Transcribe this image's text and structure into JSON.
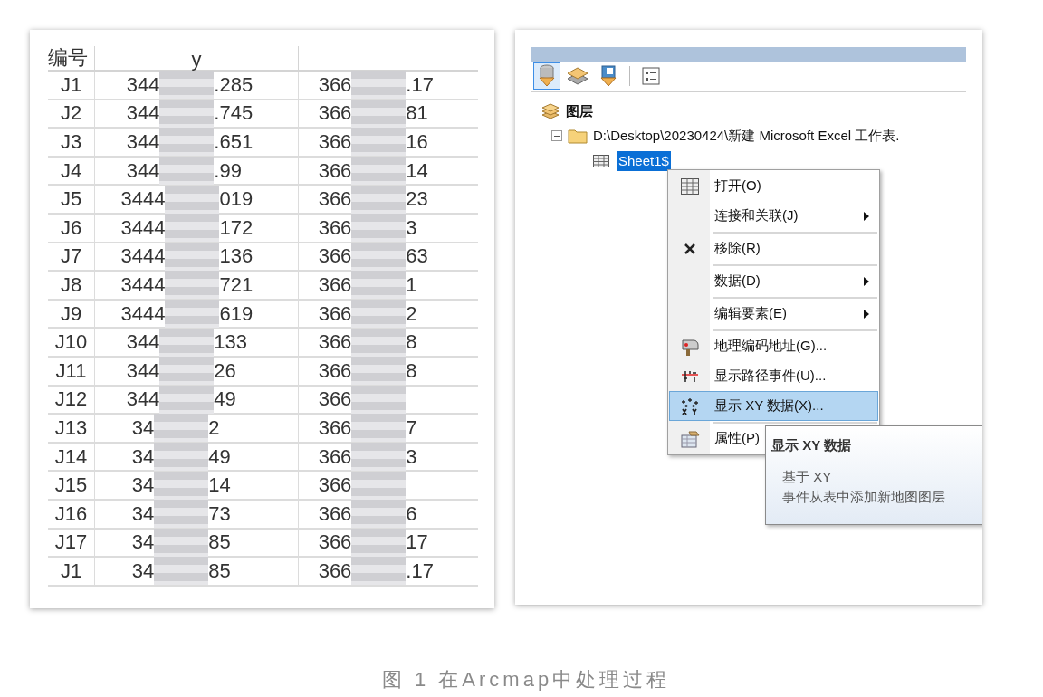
{
  "table": {
    "columns": [
      {
        "label": "编号"
      },
      {
        "label": "y"
      }
    ],
    "rows": [
      {
        "id": "J1",
        "y": {
          "start": "344",
          "end": ".285"
        },
        "column_3": {
          "start": "366",
          "end": ".17"
        }
      },
      {
        "id": "J2",
        "y": {
          "start": "344",
          "end": ".745"
        },
        "column_3": {
          "start": "366",
          "end": "81"
        }
      },
      {
        "id": "J3",
        "y": {
          "start": "344",
          "end": ".651"
        },
        "column_3": {
          "start": "366",
          "end": "16"
        }
      },
      {
        "id": "J4",
        "y": {
          "start": "344",
          "end": ".99"
        },
        "column_3": {
          "start": "366",
          "end": "14"
        }
      },
      {
        "id": "J5",
        "y": {
          "start": "3444",
          "end": "019"
        },
        "column_3": {
          "start": "366",
          "end": "23"
        }
      },
      {
        "id": "J6",
        "y": {
          "start": "3444",
          "end": "172"
        },
        "column_3": {
          "start": "366",
          "end": "3"
        }
      },
      {
        "id": "J7",
        "y": {
          "start": "3444",
          "end": "136"
        },
        "column_3": {
          "start": "366",
          "end": "63"
        }
      },
      {
        "id": "J8",
        "y": {
          "start": "3444",
          "end": "721"
        },
        "column_3": {
          "start": "366",
          "end": "1"
        }
      },
      {
        "id": "J9",
        "y": {
          "start": "3444",
          "end": "619"
        },
        "column_3": {
          "start": "366",
          "end": "2"
        }
      },
      {
        "id": "J10",
        "y": {
          "start": "344",
          "end": "133"
        },
        "column_3": {
          "start": "366",
          "end": "8"
        }
      },
      {
        "id": "J11",
        "y": {
          "start": "344",
          "end": "26"
        },
        "column_3": {
          "start": "366",
          "end": "8"
        }
      },
      {
        "id": "J12",
        "y": {
          "start": "344",
          "end": "49"
        },
        "column_3": {
          "start": "366"
        }
      },
      {
        "id": "J13",
        "y": {
          "start": "34",
          "end": "2"
        },
        "column_3": {
          "start": "366",
          "end": "7"
        }
      },
      {
        "id": "J14",
        "y": {
          "start": "34",
          "end": "49"
        },
        "column_3": {
          "start": "366",
          "end": "3"
        }
      },
      {
        "id": "J15",
        "y": {
          "start": "34",
          "end": "14"
        },
        "column_3": {
          "start": "366"
        }
      },
      {
        "id": "J16",
        "y": {
          "start": "34",
          "end": "73"
        },
        "column_3": {
          "start": "366",
          "end": "6"
        }
      },
      {
        "id": "J17",
        "y": {
          "start": "34",
          "end": "85"
        },
        "column_3": {
          "start": "366",
          "end": "17"
        }
      },
      {
        "id": "J1",
        "y": {
          "start": "34",
          "end": "85"
        },
        "column_3": {
          "start": "366",
          "end": ".17"
        }
      }
    ]
  },
  "toc": {
    "toolbar": [
      {
        "kind": "database",
        "selected": true
      },
      {
        "kind": "layers",
        "selected": false
      },
      {
        "kind": "source",
        "selected": false
      },
      {
        "kind": "options",
        "selected": false
      }
    ],
    "tree": {
      "label": "图层",
      "children": [
        {
          "label": "D:\\Desktop\\20230424\\新建 Microsoft Excel 工作表.",
          "expanded": true,
          "children": [
            {
              "label": "Sheet1$",
              "selected": true
            }
          ]
        }
      ]
    }
  },
  "context_menu": [
    {
      "label": "打开(O)",
      "kind": "table",
      "submenu": false,
      "selected": false,
      "separator_before": false
    },
    {
      "label": "连接和关联(J)",
      "kind": "plain",
      "submenu": true,
      "selected": false,
      "separator_before": false
    },
    {
      "label": "移除(R)",
      "kind": "remove",
      "submenu": false,
      "selected": false,
      "separator_before": true
    },
    {
      "label": "数据(D)",
      "kind": "plain",
      "submenu": true,
      "selected": false,
      "separator_before": true
    },
    {
      "label": "编辑要素(E)",
      "kind": "plain",
      "submenu": true,
      "selected": false,
      "separator_before": true
    },
    {
      "label": "地理编码地址(G)...",
      "kind": "geocode",
      "submenu": false,
      "selected": false,
      "separator_before": true
    },
    {
      "label": "显示路径事件(U)...",
      "kind": "route",
      "submenu": false,
      "selected": false,
      "separator_before": false
    },
    {
      "label": "显示 XY 数据(X)...",
      "kind": "xy",
      "submenu": false,
      "selected": true,
      "separator_before": false
    },
    {
      "label": "属性(P)",
      "kind": "properties",
      "submenu": false,
      "selected": false,
      "separator_before": true
    }
  ],
  "tooltip": {
    "title": "显示 XY 数据",
    "lines": [
      "基于 XY",
      "事件从表中添加新地图图层"
    ]
  },
  "caption": "图 1 在Arcmap中处理过程"
}
